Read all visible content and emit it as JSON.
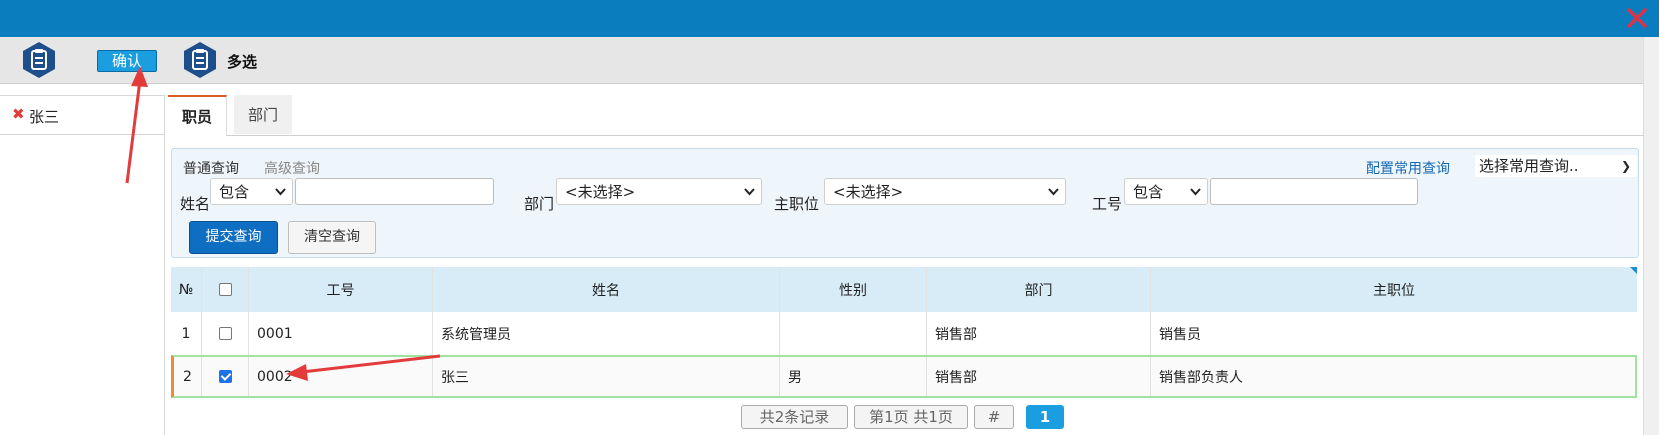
{
  "toolbar": {
    "confirm_label": "确认",
    "multi_label": "多选"
  },
  "selected": {
    "items": [
      {
        "name": "张三"
      }
    ]
  },
  "tabs": [
    {
      "label": "职员"
    },
    {
      "label": "部门"
    }
  ],
  "query": {
    "normal_label": "普通查询",
    "advanced_label": "高级查询",
    "config_label": "配置常用查询",
    "common_select": "选择常用查询..",
    "name_label": "姓名",
    "name_op": "包含",
    "dept_label": "部门",
    "dept_value": "<未选择>",
    "pos_label": "主职位",
    "pos_value": "<未选择>",
    "id_label": "工号",
    "id_op": "包含",
    "submit_label": "提交查询",
    "clear_label": "清空查询"
  },
  "grid": {
    "headers": {
      "no": "№",
      "id": "工号",
      "name": "姓名",
      "gender": "性别",
      "dept": "部门",
      "position": "主职位"
    },
    "rows": [
      {
        "no": "1",
        "checked": false,
        "id": "0001",
        "name": "系统管理员",
        "gender": "",
        "dept": "销售部",
        "position": "销售员"
      },
      {
        "no": "2",
        "checked": true,
        "id": "0002",
        "name": "张三",
        "gender": "男",
        "dept": "销售部",
        "position": "销售部负责人"
      }
    ]
  },
  "pager": {
    "total": "共2条记录",
    "page_info": "第1页 共1页",
    "hash": "#",
    "current": "1"
  },
  "colors": {
    "titlebar": "#0a7dbf",
    "accent": "#1a9ee0",
    "annotation": "#e33b3b"
  }
}
